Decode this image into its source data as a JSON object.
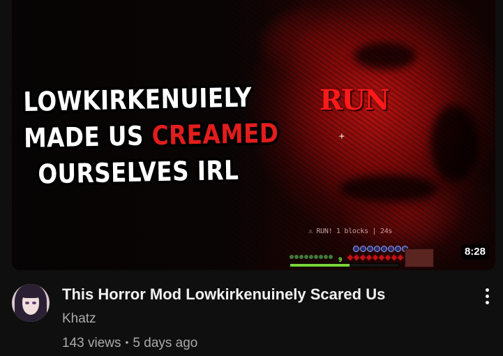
{
  "thumbnail": {
    "overlay_title_lines": [
      {
        "parts": [
          {
            "text": "LOWKIRKENUIELY",
            "highlight": false
          }
        ]
      },
      {
        "parts": [
          {
            "text": "MADE US ",
            "highlight": false
          },
          {
            "text": "CREAMED",
            "highlight": true
          }
        ]
      },
      {
        "parts": [
          {
            "text": "OURSELVES IRL",
            "highlight": false
          }
        ]
      }
    ],
    "overlay_run_text": "RUN",
    "crosshair": "+",
    "hud_status": "⚠ RUN! 1 blocks | 24s",
    "hud_level": "9",
    "hud_xp_fraction": 0.55,
    "duration": "8:28",
    "colors": {
      "highlight": "#e21d1d",
      "run": "#ff1a1a"
    }
  },
  "video": {
    "title": "This Horror Mod Lowkirkenuinely Scared Us",
    "channel": "Khatz",
    "views": "143 views",
    "separator": "•",
    "age": "5 days ago"
  },
  "icons": {
    "menu": "more-vert-icon",
    "avatar": "channel-avatar"
  }
}
